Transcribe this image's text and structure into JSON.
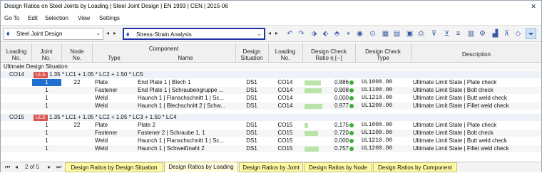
{
  "window": {
    "title": "Design Ratios on Steel Joints by Loading | Steel Joint Design | EN 1993 | CEN | 2015-06",
    "close": "✕"
  },
  "menu": [
    "Go To",
    "Edit",
    "Selection",
    "View",
    "Settings"
  ],
  "toolbar": {
    "module": "Steel Joint Design",
    "analysis": "Stress-Strain Analysis"
  },
  "columns": {
    "loading_no": [
      "Loading",
      "No."
    ],
    "joint_no": [
      "Joint",
      "No."
    ],
    "node_no": [
      "Node",
      "No."
    ],
    "component": "Component",
    "type": "Type",
    "name": "Name",
    "design_situation": [
      "Design",
      "Situation"
    ],
    "loading_no2": [
      "Loading",
      "No."
    ],
    "design_check_ratio": [
      "Design Check",
      "Ratio η [--]"
    ],
    "design_check_type": [
      "Design Check",
      "Type"
    ],
    "description": "Description"
  },
  "section": "Ultimate Design Situation",
  "groups": [
    {
      "loading": "CO14",
      "badge": "ULS",
      "formula": "1.35 * LC1 + 1.05 * LC2 + 1.50 * LC5",
      "rows": [
        {
          "joint": "1",
          "node": "22",
          "type": "Plate",
          "name": "End Plate 1 | Blech 1",
          "ds": "DS1",
          "lo": "CO14",
          "ratio": "0.886",
          "ratio_val": 0.886,
          "dct": "UL1000.00",
          "desc": "Ultimate Limit State | Plate check"
        },
        {
          "joint": "1",
          "node": "",
          "type": "Fastener",
          "name": "End Plate 1 | Schraubengruppe ...",
          "ds": "DS1",
          "lo": "CO14",
          "ratio": "0.908",
          "ratio_val": 0.908,
          "dct": "UL1100.00",
          "desc": "Ultimate Limit State | Bolt check"
        },
        {
          "joint": "1",
          "node": "",
          "type": "Weld",
          "name": "Haunch 1 | Flanschschnitt 1 | Sc...",
          "ds": "DS1",
          "lo": "CO14",
          "ratio": "0.000",
          "ratio_val": 0.0,
          "dct": "UL1210.00",
          "desc": "Ultimate Limit State | Butt weld check"
        },
        {
          "joint": "1",
          "node": "",
          "type": "Weld",
          "name": "Haunch 1 | Blechschnitt 2 | Schw...",
          "ds": "DS1",
          "lo": "CO14",
          "ratio": "0.977",
          "ratio_val": 0.977,
          "dct": "UL1200.00",
          "desc": "Ultimate Limit State | Fillet weld check"
        }
      ]
    },
    {
      "loading": "CO15",
      "badge": "ULS",
      "formula": "1.35 * LC1 + 1.05 * LC2 + 1.05 * LC3 + 1.50 * LC4",
      "rows": [
        {
          "joint": "1",
          "node": "22",
          "type": "Plate",
          "name": "Plate 2",
          "ds": "DS1",
          "lo": "CO15",
          "ratio": "0.175",
          "ratio_val": 0.175,
          "dct": "UL1000.00",
          "desc": "Ultimate Limit State | Plate check"
        },
        {
          "joint": "1",
          "node": "",
          "type": "Fastener",
          "name": "Fastener 2 | Schraube 1, 1",
          "ds": "DS1",
          "lo": "CO15",
          "ratio": "0.720",
          "ratio_val": 0.72,
          "dct": "UL1100.00",
          "desc": "Ultimate Limit State | Bolt check"
        },
        {
          "joint": "1",
          "node": "",
          "type": "Weld",
          "name": "Haunch 1 | Flanschschnitt 1 | Sc...",
          "ds": "DS1",
          "lo": "CO15",
          "ratio": "0.000",
          "ratio_val": 0.0,
          "dct": "UL1210.00",
          "desc": "Ultimate Limit State | Butt weld check"
        },
        {
          "joint": "1",
          "node": "",
          "type": "Weld",
          "name": "Haunch 1 | Schweißnaht 2",
          "ds": "DS1",
          "lo": "CO15",
          "ratio": "0.757",
          "ratio_val": 0.757,
          "dct": "UL1200.00",
          "desc": "Ultimate Limit State | Fillet weld check"
        }
      ]
    }
  ],
  "pager": {
    "text": "2 of 5"
  },
  "tabs": [
    "Design Ratios by Design Situation",
    "Design Ratios by Loading",
    "Design Ratios by Joint",
    "Design Ratios by Node",
    "Design Ratios by Component"
  ],
  "active_tab": 1,
  "colors": {
    "uls": "#d9534f",
    "ratio_bar": "#b9e3a8",
    "ok_dot": "#35b035",
    "tab": "#fff9a3",
    "highlight": "#2131a8"
  }
}
